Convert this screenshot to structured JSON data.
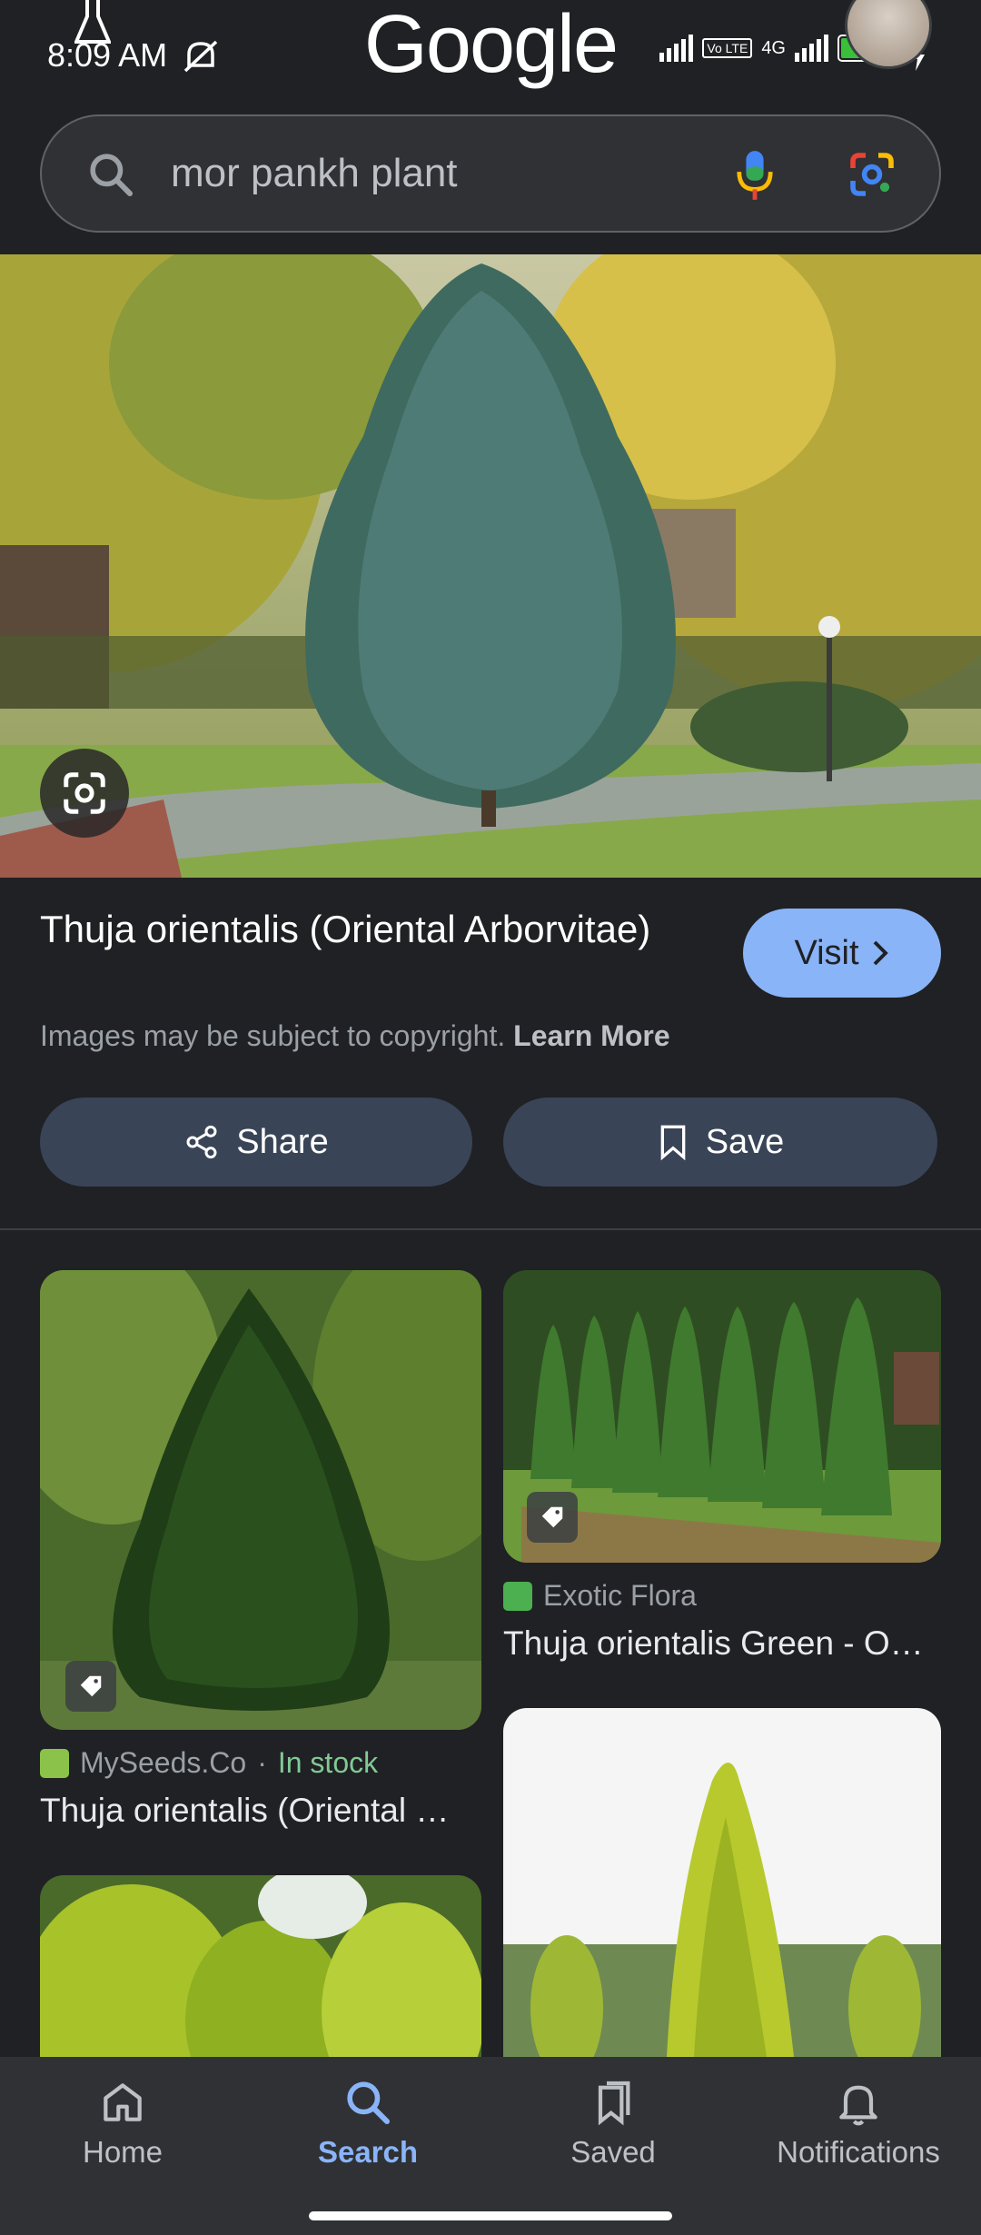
{
  "status_bar": {
    "time": "8:09 AM",
    "network": "4G",
    "volte": "Vo LTE",
    "battery": "93"
  },
  "header": {
    "logo": "Google"
  },
  "search": {
    "query": "mor pankh plant",
    "icons": [
      "search-icon",
      "mic-icon",
      "google-lens-icon"
    ]
  },
  "result": {
    "title": "Thuja orientalis (Oriental Arborvitae)",
    "visit_label": "Visit",
    "copyright_text": "Images may be subject to copyright.",
    "learn_more": "Learn More",
    "share_label": "Share",
    "save_label": "Save"
  },
  "related": [
    {
      "source": "MySeeds.Co",
      "separator": "·",
      "stock": "In stock",
      "title": "Thuja orientalis (Oriental …",
      "favicon_color": "#8bc34a"
    },
    {
      "source": "Exotic Flora",
      "title": "Thuja orientalis Green - O…",
      "favicon_color": "#4caf50"
    }
  ],
  "nav": {
    "items": [
      {
        "label": "Home",
        "icon": "home-icon"
      },
      {
        "label": "Search",
        "icon": "search-icon",
        "active": true
      },
      {
        "label": "Saved",
        "icon": "saved-icon"
      },
      {
        "label": "Notifications",
        "icon": "bell-icon"
      }
    ]
  },
  "colors": {
    "background": "#202124",
    "accent": "#8ab4f8",
    "button": "#394457",
    "in_stock": "#81c995"
  }
}
